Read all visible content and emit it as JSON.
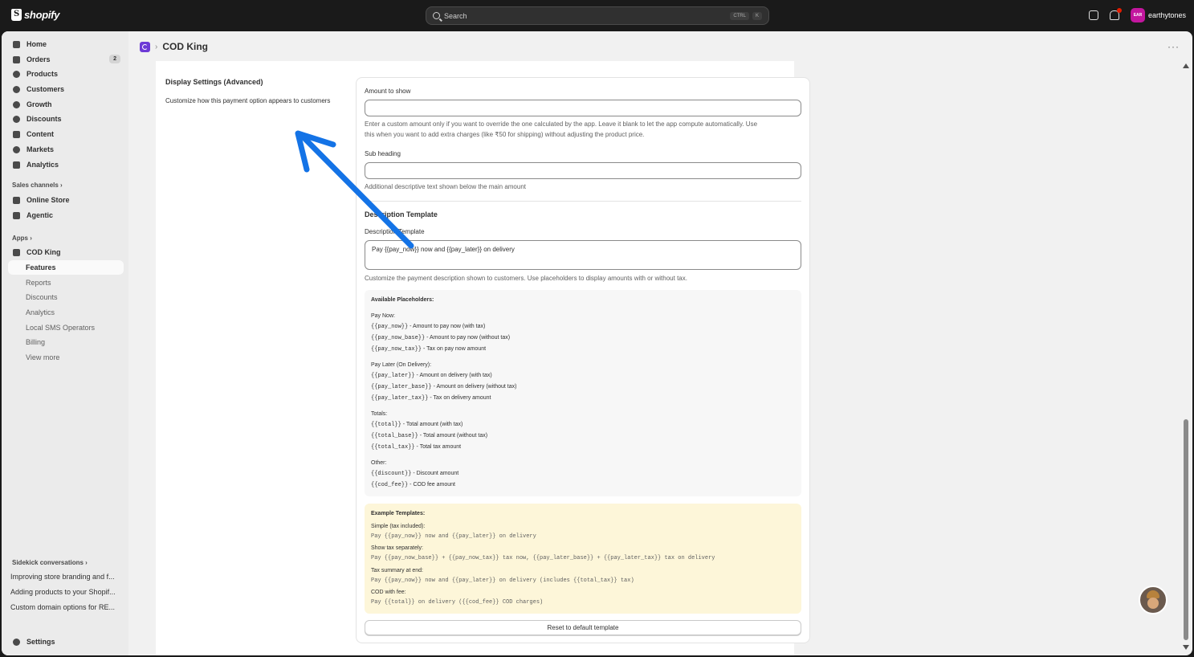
{
  "topbar": {
    "logo_text": "shopify",
    "search_placeholder": "Search",
    "shortcut_ctrl": "CTRL",
    "shortcut_key": "K",
    "store_initials": "EAR",
    "store_name": "earthytones"
  },
  "sidebar": {
    "nav": [
      {
        "label": "Home",
        "icon": "home-icon"
      },
      {
        "label": "Orders",
        "icon": "orders-icon",
        "badge": "2"
      },
      {
        "label": "Products",
        "icon": "tag-icon"
      },
      {
        "label": "Customers",
        "icon": "person-icon"
      },
      {
        "label": "Growth",
        "icon": "growth-icon"
      },
      {
        "label": "Discounts",
        "icon": "discount-icon"
      },
      {
        "label": "Content",
        "icon": "content-icon"
      },
      {
        "label": "Markets",
        "icon": "globe-icon"
      },
      {
        "label": "Analytics",
        "icon": "chart-icon"
      }
    ],
    "sales_channels_label": "Sales channels",
    "channels": [
      {
        "label": "Online Store",
        "icon": "store-icon"
      },
      {
        "label": "Agentic",
        "icon": "agentic-icon"
      }
    ],
    "apps_label": "Apps",
    "app_name": "COD King",
    "app_sub": [
      "Features",
      "Reports",
      "Discounts",
      "Analytics",
      "Local SMS Operators",
      "Billing"
    ],
    "view_more": "View more",
    "sidekick_label": "Sidekick conversations",
    "conversations": [
      "Improving store branding and f...",
      "Adding products to your Shopif...",
      "Custom domain options for RE..."
    ],
    "settings_label": "Settings"
  },
  "page": {
    "breadcrumb_app": "COD King",
    "more": "···"
  },
  "section": {
    "title": "Display Settings (Advanced)",
    "description": "Customize how this payment option appears to customers"
  },
  "form": {
    "amount_label": "Amount to show",
    "amount_value": "",
    "amount_help_1": "Enter a custom amount only if you want to override the one calculated by the app. Leave it blank to let the app compute automatically. Use",
    "amount_help_2": "this when you want to add extra charges (like ₹50 for shipping) without adjusting the product price.",
    "subheading_label": "Sub heading",
    "subheading_value": "",
    "subheading_help": "Additional descriptive text shown below the main amount",
    "desc_section_title": "Description Template",
    "desc_label": "Description Template",
    "desc_value": "Pay {{pay_now}} now and {{pay_later}} on delivery",
    "desc_help": "Customize the payment description shown to customers. Use placeholders to display amounts with or without tax."
  },
  "placeholders": {
    "title": "Available Placeholders:",
    "groups": [
      {
        "heading": "Pay Now:",
        "items": [
          {
            "code": "{{pay_now}}",
            "desc": " - Amount to pay now (with tax)"
          },
          {
            "code": "{{pay_now_base}}",
            "desc": " - Amount to pay now (without tax)"
          },
          {
            "code": "{{pay_now_tax}}",
            "desc": " - Tax on pay now amount"
          }
        ]
      },
      {
        "heading": "Pay Later (On Delivery):",
        "items": [
          {
            "code": "{{pay_later}}",
            "desc": " - Amount on delivery (with tax)"
          },
          {
            "code": "{{pay_later_base}}",
            "desc": " - Amount on delivery (without tax)"
          },
          {
            "code": "{{pay_later_tax}}",
            "desc": " - Tax on delivery amount"
          }
        ]
      },
      {
        "heading": "Totals:",
        "items": [
          {
            "code": "{{total}}",
            "desc": " - Total amount (with tax)"
          },
          {
            "code": "{{total_base}}",
            "desc": " - Total amount (without tax)"
          },
          {
            "code": "{{total_tax}}",
            "desc": " - Total tax amount"
          }
        ]
      },
      {
        "heading": "Other:",
        "items": [
          {
            "code": "{{discount}}",
            "desc": " - Discount amount"
          },
          {
            "code": "{{cod_fee}}",
            "desc": " - COD fee amount"
          }
        ]
      }
    ]
  },
  "examples": {
    "title": "Example Templates:",
    "items": [
      {
        "label": "Simple (tax included):",
        "template": "Pay {{pay_now}} now and {{pay_later}} on delivery"
      },
      {
        "label": "Show tax separately:",
        "template": "Pay {{pay_now_base}} + {{pay_now_tax}} tax now, {{pay_later_base}} + {{pay_later_tax}} tax on delivery"
      },
      {
        "label": "Tax summary at end:",
        "template": "Pay {{pay_now}} now and {{pay_later}} on delivery (includes {{total_tax}} tax)"
      },
      {
        "label": "COD with fee:",
        "template": "Pay {{total}} on delivery ({{cod_fee}} COD charges)"
      }
    ]
  },
  "reset_button": "Reset to default template",
  "colors": {
    "annotation_arrow": "#1473e6",
    "topbar_bg": "#1a1a1a",
    "example_bg": "#fdf6d9"
  }
}
